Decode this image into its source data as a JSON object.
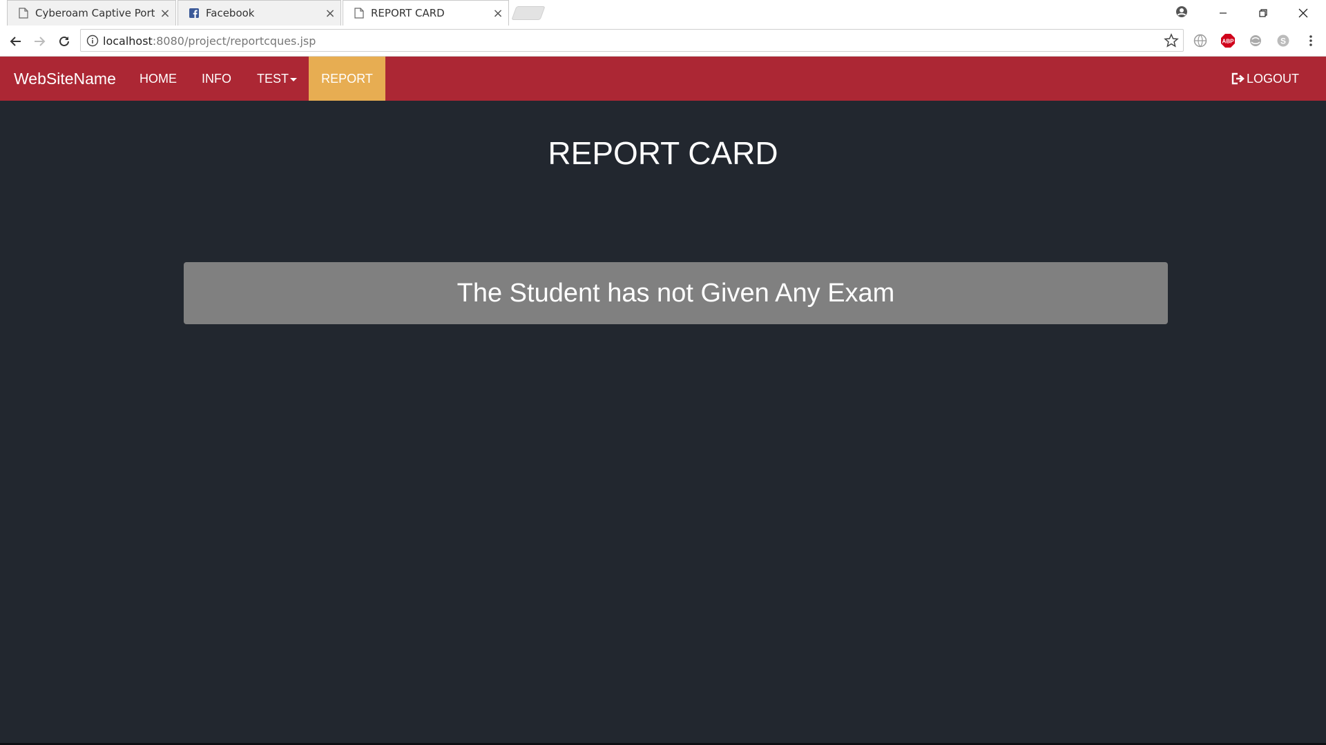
{
  "browser": {
    "tabs": [
      {
        "title": "Cyberoam Captive Portal",
        "icon": "page-icon",
        "active": false
      },
      {
        "title": "Facebook",
        "icon": "facebook-icon",
        "active": false
      },
      {
        "title": "REPORT CARD",
        "icon": "page-icon",
        "active": true
      }
    ],
    "url_host": "localhost",
    "url_rest": ":8080/project/reportcques.jsp",
    "extensions": [
      "globe-icon",
      "adblock-plus-icon",
      "extension-icon",
      "skype-icon"
    ],
    "adblock_label": "ABP"
  },
  "navbar": {
    "brand": "WebSiteName",
    "links": [
      {
        "label": "HOME",
        "active": false
      },
      {
        "label": "INFO",
        "active": false
      },
      {
        "label": "TEST",
        "active": false,
        "dropdown": true
      },
      {
        "label": "REPORT",
        "active": true
      }
    ],
    "logout_label": "LOGOUT",
    "colors": {
      "background": "#ac2734",
      "active": "#e7ad52"
    }
  },
  "main": {
    "title": "REPORT CARD",
    "message": "The Student has not Given Any Exam",
    "colors": {
      "page_background": "#22272f",
      "message_background": "#808080"
    }
  }
}
